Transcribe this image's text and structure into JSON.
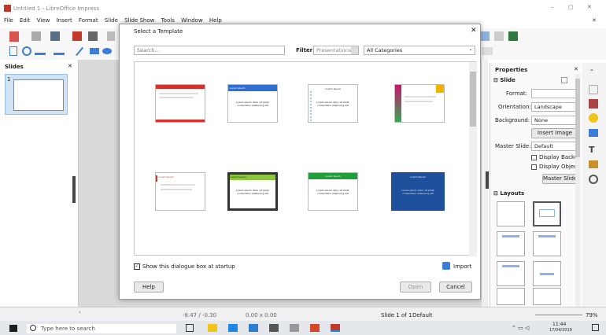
{
  "window": {
    "title": "Untitled 1 - LibreOffice Impress"
  },
  "menu": [
    "File",
    "Edit",
    "View",
    "Insert",
    "Format",
    "Slide",
    "Slide Show",
    "Tools",
    "Window",
    "Help"
  ],
  "slides_panel": {
    "title": "Slides",
    "slide_number": "1"
  },
  "dialog": {
    "title": "Select a Template",
    "search_placeholder": "Search...",
    "filter_label": "Filter",
    "filter_value": "Presentations",
    "category_value": "All Categories",
    "show_checkbox_label": "Show this dialogue box at startup",
    "import_label": "Import",
    "help_label": "Help",
    "open_label": "Open",
    "cancel_label": "Cancel",
    "templates": [
      {
        "heading": "",
        "accent": "#d9302c",
        "text": ""
      },
      {
        "heading": "Lorem Ipsum",
        "accent": "#2f6fcf",
        "text": "Lorem ipsum dolor sit amet consectetur adipiscing elit"
      },
      {
        "heading": "Lorem Ipsum",
        "accent": "#ffffff",
        "text": "Lorem ipsum dolor sit amet consectetur adipiscing elit"
      },
      {
        "heading": "",
        "accent": "#c4176c",
        "text": ""
      },
      {
        "heading": "Lorem Ipsum",
        "accent": "#c0392b",
        "text": ""
      },
      {
        "heading": "Lorem Ipsum",
        "accent": "#8cc63f",
        "text": "Lorem ipsum dolor sit amet consectetur adipiscing elit"
      },
      {
        "heading": "Lorem Ipsum",
        "accent": "#1f9e3a",
        "text": "Lorem ipsum dolor sit amet consectetur adipiscing elit"
      },
      {
        "heading": "Lorem Ipsum",
        "accent": "#1d4f9c",
        "text": "Lorem ipsum dolor sit amet consectetur adipiscing elit"
      }
    ]
  },
  "properties": {
    "title": "Properties",
    "slide_section": "Slide",
    "format_label": "Format:",
    "format_value": "",
    "orientation_label": "Orientation:",
    "orientation_value": "Landscape",
    "background_label": "Background:",
    "background_value": "None",
    "insert_image_label": "Insert Image",
    "master_slide_label": "Master Slide:",
    "master_slide_value": "Default",
    "display_background_label": "Display Background",
    "display_objects_label": "Display Objects",
    "master_slides_button": "Master Slides",
    "layouts_section": "Layouts"
  },
  "statusbar": {
    "position": "-8.47 / -0.30",
    "size": "0.00 x 0.00",
    "slide": "Slide 1 of 1",
    "master": "Default",
    "zoom": "79%"
  },
  "taskbar": {
    "search_placeholder": "Type here to search",
    "time": "11:44",
    "date": "17/04/2019"
  }
}
